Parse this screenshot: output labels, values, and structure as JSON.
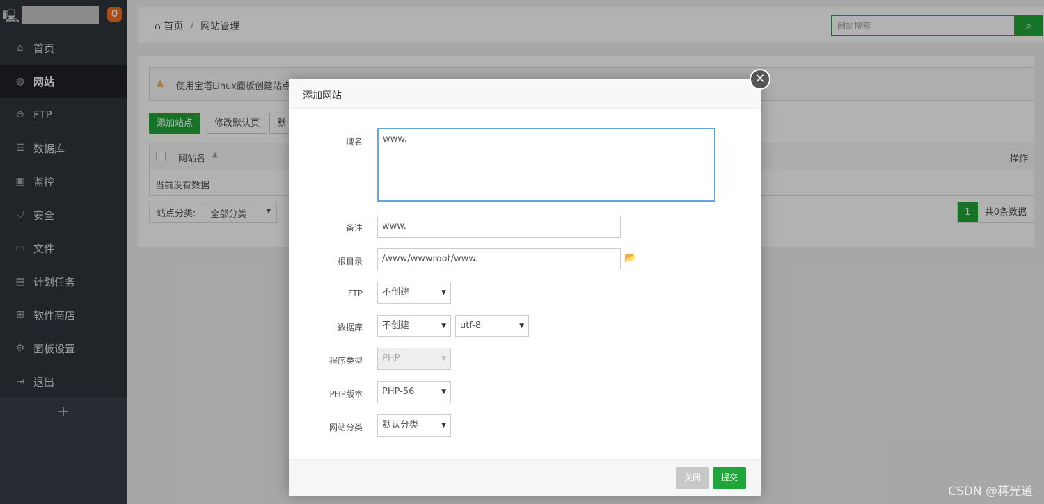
{
  "sidebar": {
    "badge": "0",
    "items": [
      {
        "label": "首页",
        "icon": "home-icon"
      },
      {
        "label": "网站",
        "icon": "globe-icon",
        "active": true
      },
      {
        "label": "FTP",
        "icon": "ftp-icon"
      },
      {
        "label": "数据库",
        "icon": "database-icon"
      },
      {
        "label": "监控",
        "icon": "monitor-icon"
      },
      {
        "label": "安全",
        "icon": "shield-icon"
      },
      {
        "label": "文件",
        "icon": "folder-icon"
      },
      {
        "label": "计划任务",
        "icon": "calendar-icon"
      },
      {
        "label": "软件商店",
        "icon": "grid-icon"
      },
      {
        "label": "面板设置",
        "icon": "gear-icon"
      },
      {
        "label": "退出",
        "icon": "logout-icon"
      }
    ],
    "add": "+"
  },
  "header": {
    "breadcrumb": [
      "首页",
      "网站管理"
    ],
    "separator": "/",
    "search_placeholder": "网站搜索"
  },
  "content": {
    "alert": "使用宝塔Linux面板创建站点时",
    "buttons": [
      "添加站点",
      "修改默认页",
      "默认"
    ],
    "table": {
      "col_name": "网站名",
      "col_action": "操作",
      "empty": "当前没有数据"
    },
    "filter_label": "站点分类:",
    "filter_value": "全部分类",
    "page": "1",
    "total": "共0条数据"
  },
  "modal": {
    "title": "添加网站",
    "fields": {
      "domain": {
        "label": "域名",
        "value": "www."
      },
      "note": {
        "label": "备注",
        "value": "www."
      },
      "root": {
        "label": "根目录",
        "value": "/www/wwwroot/www."
      },
      "ftp": {
        "label": "FTP",
        "value": "不创建"
      },
      "db": {
        "label": "数据库",
        "value": "不创建",
        "charset": "utf-8"
      },
      "type": {
        "label": "程序类型",
        "value": "PHP"
      },
      "php": {
        "label": "PHP版本",
        "value": "PHP-56"
      },
      "category": {
        "label": "网站分类",
        "value": "默认分类"
      }
    },
    "close": "关闭",
    "submit": "提交"
  },
  "watermark": "CSDN @蒋光道",
  "colors": {
    "accent": "#20a53a",
    "badge": "#f26d21"
  }
}
